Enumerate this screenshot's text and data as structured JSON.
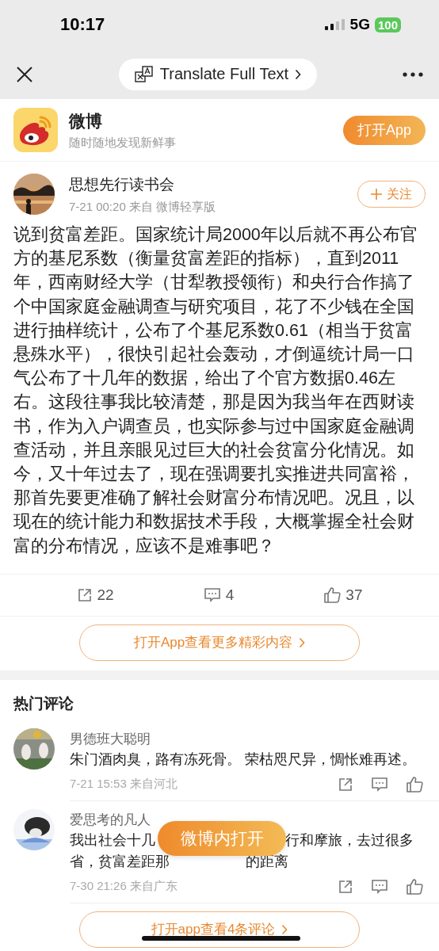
{
  "status_bar": {
    "time": "10:17",
    "network": "5G",
    "battery": "100"
  },
  "nav": {
    "translate_label": "Translate Full Text"
  },
  "app_banner": {
    "name": "微博",
    "tagline": "随时随地发现新鲜事",
    "open_button": "打开App"
  },
  "post": {
    "author": "思想先行读书会",
    "meta": "7-21 00:20 来自 微博轻享版",
    "follow_label": "关注",
    "text": "说到贫富差距。国家统计局2000年以后就不再公布官方的基尼系数（衡量贫富差距的指标），直到2011年，西南财经大学（甘犁教授领衔）和央行合作搞了个中国家庭金融调查与研究项目，花了不少钱在全国进行抽样统计，公布了个基尼系数0.61（相当于贫富悬殊水平），很快引起社会轰动，才倒逼统计局一口气公布了十几年的数据，给出了个官方数据0.46左右。这段往事我比较清楚，那是因为我当年在西财读书，作为入户调查员，也实际参与过中国家庭金融调查活动，并且亲眼见过巨大的社会贫富分化情况。如今，又十年过去了，现在强调要扎实推进共同富裕，那首先要更准确了解社会财富分布情况吧。况且，以现在的统计能力和数据技术手段，大概掌握全社会财富的分布情况，应该不是难事吧？",
    "reposts": "22",
    "comments": "4",
    "likes": "37",
    "more_button": "打开App查看更多精彩内容"
  },
  "comments_section": {
    "title": "热门评论",
    "comments": [
      {
        "author": "男德班大聪明",
        "lines": [
          [
            "朱门酒肉臭，路有冻死骨。 荣枯咫尺异，惆怅难再述。"
          ]
        ],
        "meta": "7-21 15:53 来自河北"
      },
      {
        "author": "爱思考的凡人",
        "lines": [
          [
            "我出社会十几",
            "行和摩旅，去过很多"
          ],
          [
            "省，贫富差距那",
            "的距离"
          ]
        ],
        "meta": "7-30 21:26 来自广东"
      }
    ],
    "more_button": "打开app查看4条评论"
  },
  "floating_button": "微博内打开"
}
